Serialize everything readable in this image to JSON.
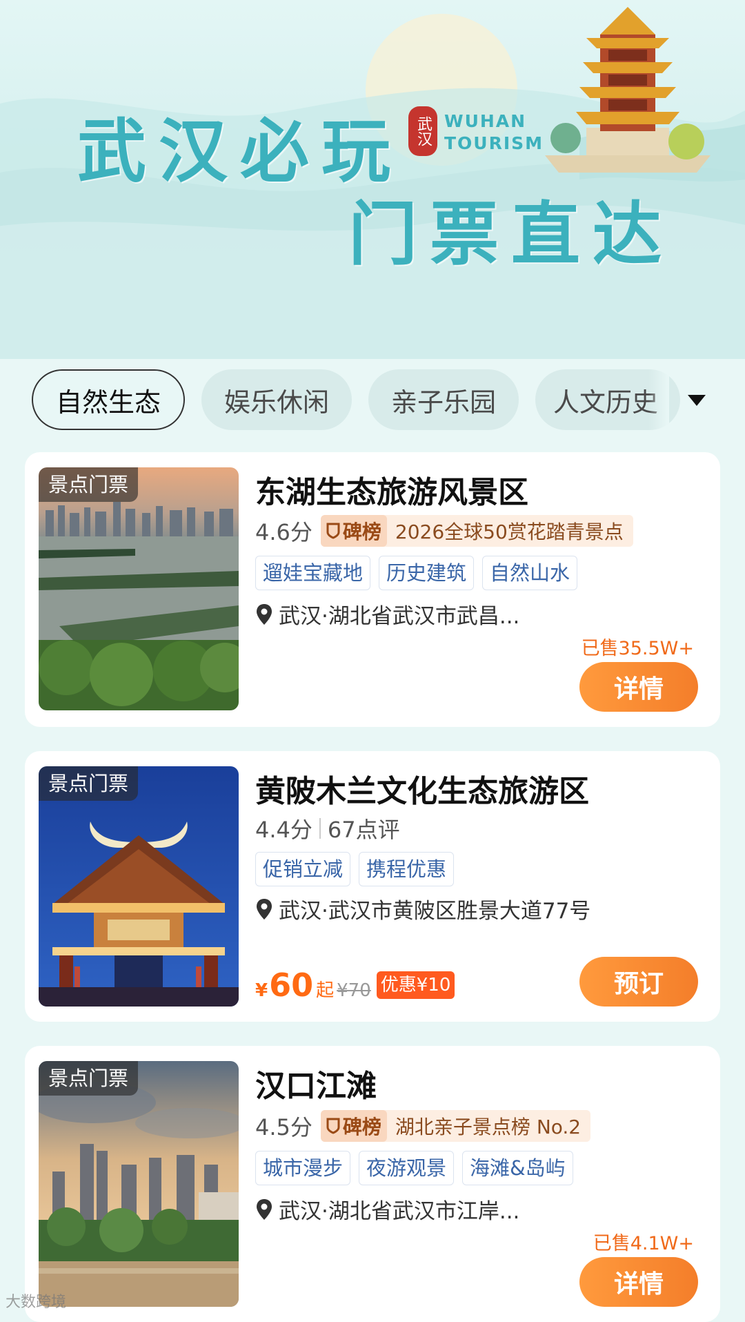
{
  "banner": {
    "title_line1": "武汉必玩",
    "title_line2": "门票直达",
    "seal_text": "武汉",
    "brand_line1": "WUHAN",
    "brand_line2": "TOURISM"
  },
  "tabs": [
    {
      "label": "自然生态",
      "active": true
    },
    {
      "label": "娱乐休闲",
      "active": false
    },
    {
      "label": "亲子乐园",
      "active": false
    },
    {
      "label": "人文历史",
      "active": false
    }
  ],
  "cards": [
    {
      "badge": "景点门票",
      "title": "东湖生态旅游风景区",
      "score": "4.6分",
      "rank_brand": "碑榜",
      "rank_text": "2026全球50赏花踏青景点",
      "tags": [
        "遛娃宝藏地",
        "历史建筑",
        "自然山水"
      ],
      "location": "武汉·湖北省武汉市武昌...",
      "sold": "已售35.5W+",
      "action": "详情"
    },
    {
      "badge": "景点门票",
      "title": "黄陂木兰文化生态旅游区",
      "score": "4.4分",
      "reviews": "67点评",
      "tags": [
        "促销立减",
        "携程优惠"
      ],
      "location": "武汉·武汉市黄陂区胜景大道77号",
      "price_symbol": "¥",
      "price": "60",
      "price_suffix": "起",
      "price_original": "¥70",
      "discount": "优惠¥10",
      "action": "预订"
    },
    {
      "badge": "景点门票",
      "title": "汉口江滩",
      "score": "4.5分",
      "rank_brand": "碑榜",
      "rank_text": "湖北亲子景点榜 No.2",
      "tags": [
        "城市漫步",
        "夜游观景",
        "海滩&岛屿"
      ],
      "location": "武汉·湖北省武汉市江岸...",
      "sold": "已售4.1W+",
      "action": "详情"
    }
  ],
  "watermark": "大数跨境",
  "colors": {
    "title_teal": "#3cb1bd",
    "accent_orange": "#f47e2a",
    "price_orange": "#ff6a13",
    "tag_blue": "#3a66a8"
  }
}
